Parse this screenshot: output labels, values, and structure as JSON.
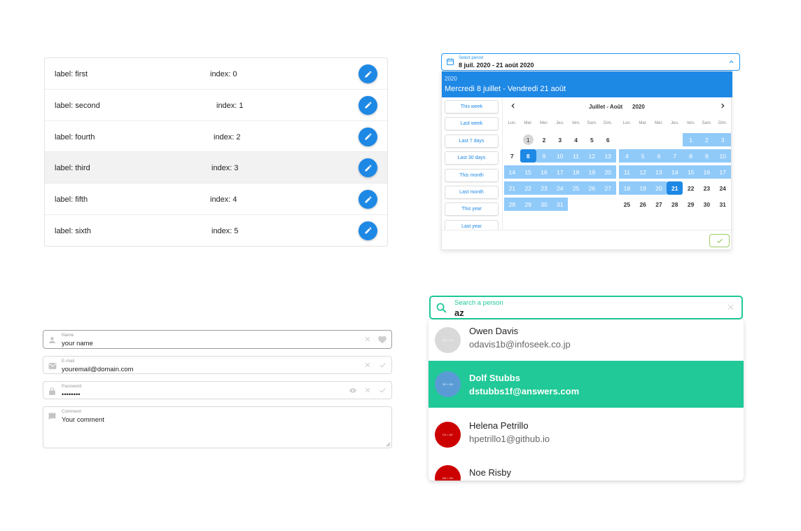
{
  "list": {
    "rows": [
      {
        "label": "label: first",
        "index": "index: 0"
      },
      {
        "label": "label: second",
        "index": "index: 1"
      },
      {
        "label": "label: fourth",
        "index": "index: 2"
      },
      {
        "label": "label: third",
        "index": "index: 3"
      },
      {
        "label": "label: fifth",
        "index": "index: 4"
      },
      {
        "label": "label: sixth",
        "index": "index: 5"
      }
    ],
    "edit_icon": "pencil-icon",
    "accent": "#1e88e5",
    "hovered_row": 3
  },
  "period": {
    "label": "Select period",
    "value": "8 juil. 2020 - 21 août 2020",
    "header_year": "2020",
    "header_range": "Mercredi 8 juillet - Vendredi 21 août",
    "presets": [
      "This week",
      "Last week",
      "Last 7 days",
      "Last 30 days",
      "This month",
      "Last month",
      "This year",
      "Last year"
    ],
    "nav_months": "Juillet - Août",
    "nav_year": "2020",
    "weekdays": [
      "Lun.",
      "Mar.",
      "Mer.",
      "Jeu.",
      "Ven.",
      "Sam.",
      "Dim."
    ],
    "months": [
      {
        "first_weekday": 2,
        "days": 31,
        "range_start": 8,
        "range_end": 31,
        "edge": 8,
        "today": 1
      },
      {
        "first_weekday": 5,
        "days": 31,
        "range_start": 1,
        "range_end": 21,
        "edge": 21,
        "today": null
      }
    ],
    "accent": "#1e88e5",
    "range_color": "#90caf9",
    "confirm_icon": "check-icon"
  },
  "form": {
    "name": {
      "label": "Name",
      "value": "your name"
    },
    "email": {
      "label": "E-mail",
      "value": "youremail@domain.com"
    },
    "password": {
      "label": "Password",
      "value": "••••••••"
    },
    "comment": {
      "label": "Comment",
      "value": "Your comment"
    }
  },
  "search": {
    "label": "Search a person",
    "value": "az",
    "accent": "#20c997",
    "results": [
      {
        "name": "Owen Davis",
        "email": "odavis1b@infoseek.co.jp",
        "avatar_text": "384 × 251",
        "avatar_color": "#d9d9d9"
      },
      {
        "name": "Dolf Stubbs",
        "email": "dstubbs1f@answers.com",
        "avatar_text": "387 × 351",
        "avatar_color": "#5b9bd5"
      },
      {
        "name": "Helena Petrillo",
        "email": "hpetrillo1@github.io",
        "avatar_text": "374 × 367",
        "avatar_color": "#cc0000"
      },
      {
        "name": "Noe Risby",
        "email": "",
        "avatar_text": "384 × 325",
        "avatar_color": "#cc0000"
      }
    ],
    "active_result": 1
  }
}
